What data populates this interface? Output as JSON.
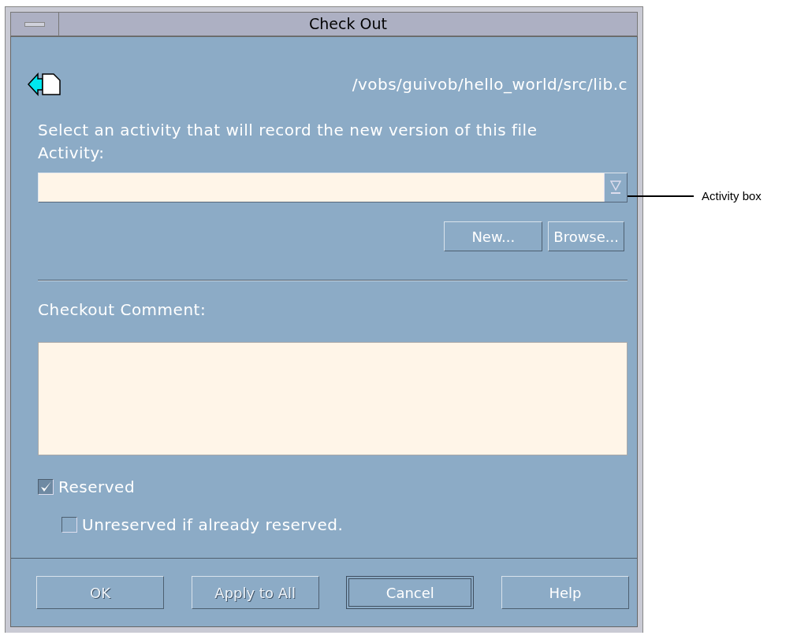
{
  "window": {
    "title": "Check Out"
  },
  "path": "/vobs/guivob/hello_world/src/lib.c",
  "instruction": "Select an activity that will record the new version of this file",
  "activity": {
    "label": "Activity:"
  },
  "activity_buttons": [
    {
      "label": "New..."
    },
    {
      "label": "Browse..."
    }
  ],
  "comment": {
    "label": "Checkout Comment:"
  },
  "options": [
    {
      "label": "Reserved",
      "checked": true,
      "indented": false
    },
    {
      "label": "Unreserved if already reserved.",
      "checked": false,
      "indented": true
    }
  ],
  "buttons": [
    {
      "label": "OK",
      "disabled": true,
      "default": false
    },
    {
      "label": "Apply to All",
      "disabled": true,
      "default": false
    },
    {
      "label": "Cancel",
      "disabled": false,
      "default": true
    },
    {
      "label": "Help",
      "disabled": false,
      "default": false
    }
  ],
  "callout": {
    "label": "Activity box"
  }
}
